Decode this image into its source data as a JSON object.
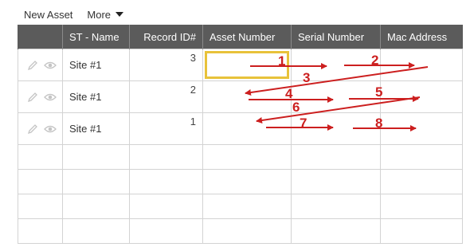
{
  "toolbar": {
    "new_asset": "New Asset",
    "more": "More"
  },
  "table": {
    "columns": [
      "",
      "ST - Name",
      "Record ID#",
      "Asset Number",
      "Serial Number",
      "Mac Address"
    ],
    "rows": [
      {
        "site": "Site #1",
        "record_id": "3",
        "asset_number": "",
        "serial_number": "",
        "mac_address": ""
      },
      {
        "site": "Site #1",
        "record_id": "2",
        "asset_number": "",
        "serial_number": "",
        "mac_address": ""
      },
      {
        "site": "Site #1",
        "record_id": "1",
        "asset_number": "",
        "serial_number": "",
        "mac_address": ""
      }
    ],
    "empty_rows": 4,
    "row_icons": [
      "pencil-icon",
      "eye-icon"
    ]
  },
  "annotations": {
    "color": "#cc1f1f",
    "focus_color": "#e8c23a",
    "labels": [
      "1",
      "2",
      "3",
      "4",
      "5",
      "6",
      "7",
      "8"
    ]
  }
}
